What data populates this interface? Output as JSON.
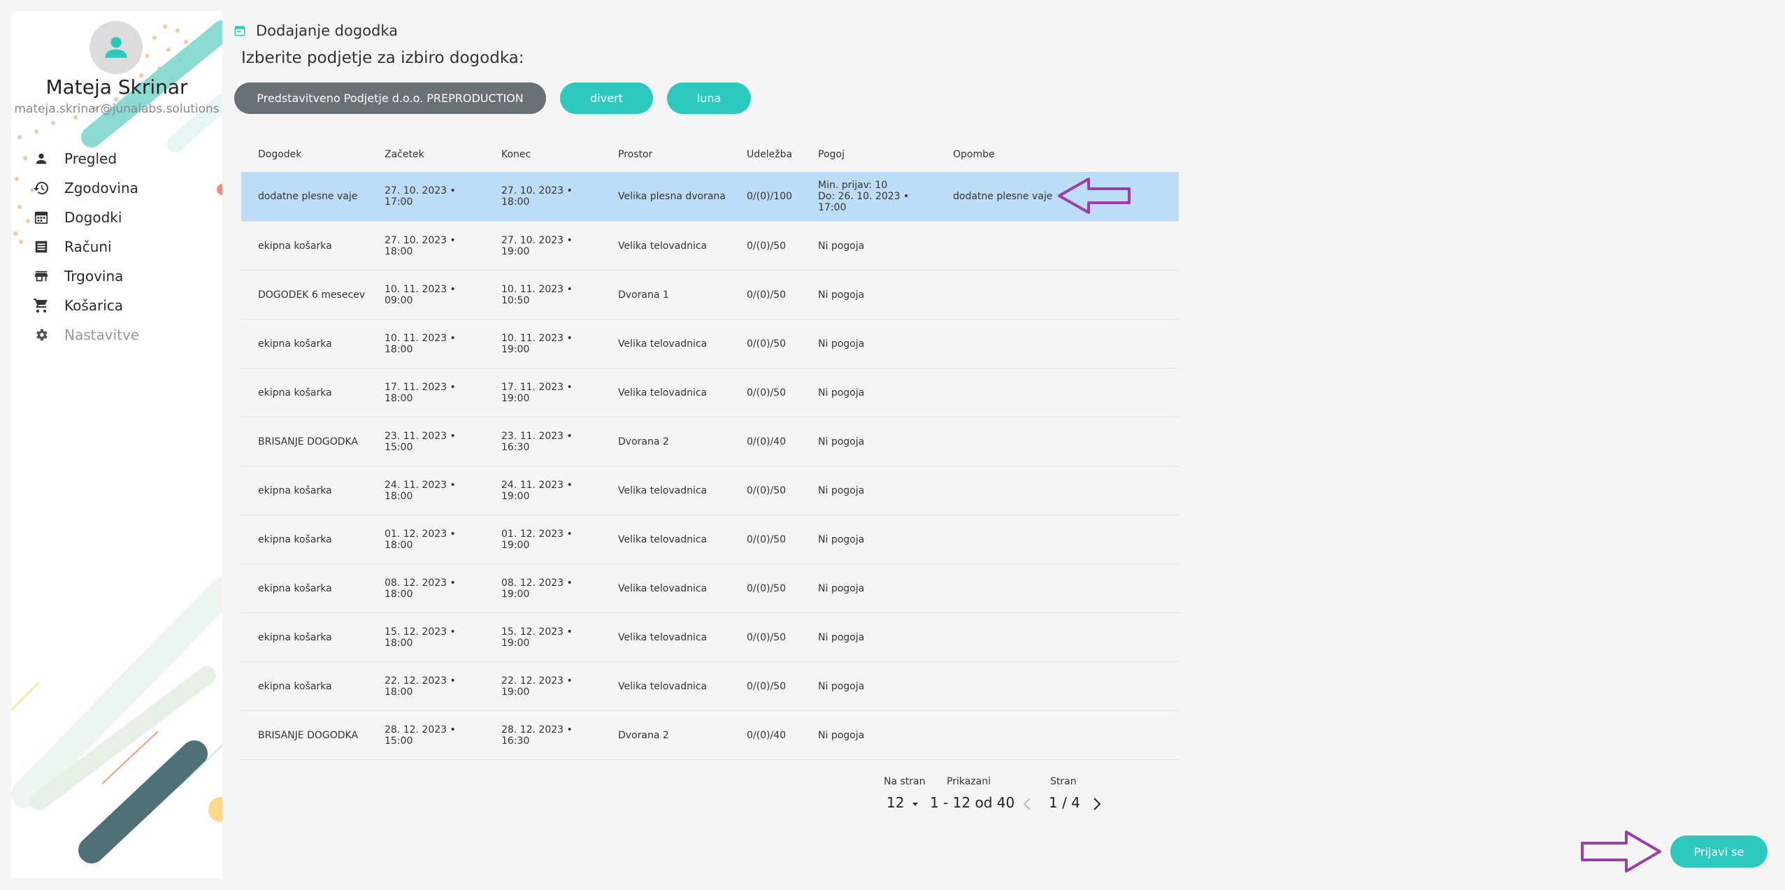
{
  "user": {
    "name": "Mateja Skrinar",
    "email": "mateja.skrinar@junalabs.solutions"
  },
  "nav": [
    {
      "label": "Pregled",
      "icon": "person-icon"
    },
    {
      "label": "Zgodovina",
      "icon": "history-icon"
    },
    {
      "label": "Dogodki",
      "icon": "calendar-icon"
    },
    {
      "label": "Računi",
      "icon": "receipt-icon"
    },
    {
      "label": "Trgovina",
      "icon": "store-icon"
    },
    {
      "label": "Košarica",
      "icon": "cart-icon"
    },
    {
      "label": "Nastavitve",
      "icon": "gear-icon"
    }
  ],
  "header": {
    "title": "Dodajanje dogodka",
    "subtitle": "Izberite podjetje za izbiro dogodka:"
  },
  "companies": [
    "Predstavitveno Podjetje d.o.o. PREPRODUCTION",
    "divert",
    "luna"
  ],
  "table": {
    "headers": [
      "Dogodek",
      "Začetek",
      "Konec",
      "Prostor",
      "Udeležba",
      "Pogoj",
      "Opombe"
    ],
    "rows": [
      {
        "event": "dodatne plesne vaje",
        "start": "27. 10. 2023 • 17:00",
        "end": "27. 10. 2023 • 18:00",
        "room": "Velika plesna dvorana",
        "attendance": "0/(0)/100",
        "condition": "Min. prijav: 10",
        "condition2": "Do: 26. 10. 2023 • 17:00",
        "notes": "dodatne plesne vaje"
      },
      {
        "event": "ekipna košarka",
        "start": "27. 10. 2023 • 18:00",
        "end": "27. 10. 2023 • 19:00",
        "room": "Velika telovadnica",
        "attendance": "0/(0)/50",
        "condition": "Ni pogoja",
        "condition2": "",
        "notes": ""
      },
      {
        "event": "DOGODEK 6 mesecev",
        "start": "10. 11. 2023 • 09:00",
        "end": "10. 11. 2023 • 10:50",
        "room": "Dvorana 1",
        "attendance": "0/(0)/50",
        "condition": "Ni pogoja",
        "condition2": "",
        "notes": ""
      },
      {
        "event": "ekipna košarka",
        "start": "10. 11. 2023 • 18:00",
        "end": "10. 11. 2023 • 19:00",
        "room": "Velika telovadnica",
        "attendance": "0/(0)/50",
        "condition": "Ni pogoja",
        "condition2": "",
        "notes": ""
      },
      {
        "event": "ekipna košarka",
        "start": "17. 11. 2023 • 18:00",
        "end": "17. 11. 2023 • 19:00",
        "room": "Velika telovadnica",
        "attendance": "0/(0)/50",
        "condition": "Ni pogoja",
        "condition2": "",
        "notes": ""
      },
      {
        "event": "BRISANJE DOGODKA",
        "start": "23. 11. 2023 • 15:00",
        "end": "23. 11. 2023 • 16:30",
        "room": "Dvorana 2",
        "attendance": "0/(0)/40",
        "condition": "Ni pogoja",
        "condition2": "",
        "notes": ""
      },
      {
        "event": "ekipna košarka",
        "start": "24. 11. 2023 • 18:00",
        "end": "24. 11. 2023 • 19:00",
        "room": "Velika telovadnica",
        "attendance": "0/(0)/50",
        "condition": "Ni pogoja",
        "condition2": "",
        "notes": ""
      },
      {
        "event": "ekipna košarka",
        "start": "01. 12. 2023 • 18:00",
        "end": "01. 12. 2023 • 19:00",
        "room": "Velika telovadnica",
        "attendance": "0/(0)/50",
        "condition": "Ni pogoja",
        "condition2": "",
        "notes": ""
      },
      {
        "event": "ekipna košarka",
        "start": "08. 12. 2023 • 18:00",
        "end": "08. 12. 2023 • 19:00",
        "room": "Velika telovadnica",
        "attendance": "0/(0)/50",
        "condition": "Ni pogoja",
        "condition2": "",
        "notes": ""
      },
      {
        "event": "ekipna košarka",
        "start": "15. 12. 2023 • 18:00",
        "end": "15. 12. 2023 • 19:00",
        "room": "Velika telovadnica",
        "attendance": "0/(0)/50",
        "condition": "Ni pogoja",
        "condition2": "",
        "notes": ""
      },
      {
        "event": "ekipna košarka",
        "start": "22. 12. 2023 • 18:00",
        "end": "22. 12. 2023 • 19:00",
        "room": "Velika telovadnica",
        "attendance": "0/(0)/50",
        "condition": "Ni pogoja",
        "condition2": "",
        "notes": ""
      },
      {
        "event": "BRISANJE DOGODKA",
        "start": "28. 12. 2023 • 15:00",
        "end": "28. 12. 2023 • 16:30",
        "room": "Dvorana 2",
        "attendance": "0/(0)/40",
        "condition": "Ni pogoja",
        "condition2": "",
        "notes": ""
      }
    ]
  },
  "pagination": {
    "per_page_label": "Na stran",
    "per_page": "12",
    "shown_label": "Prikazani",
    "shown": "1 - 12 od 40",
    "page_label": "Stran",
    "page": "1 / 4"
  },
  "login_button": "Prijavi se",
  "colors": {
    "accent": "#2ec9be",
    "company_chip": "#6b6f76",
    "selected_row": "#bcdcf7",
    "annotation_arrow": "#9b3fa6"
  }
}
